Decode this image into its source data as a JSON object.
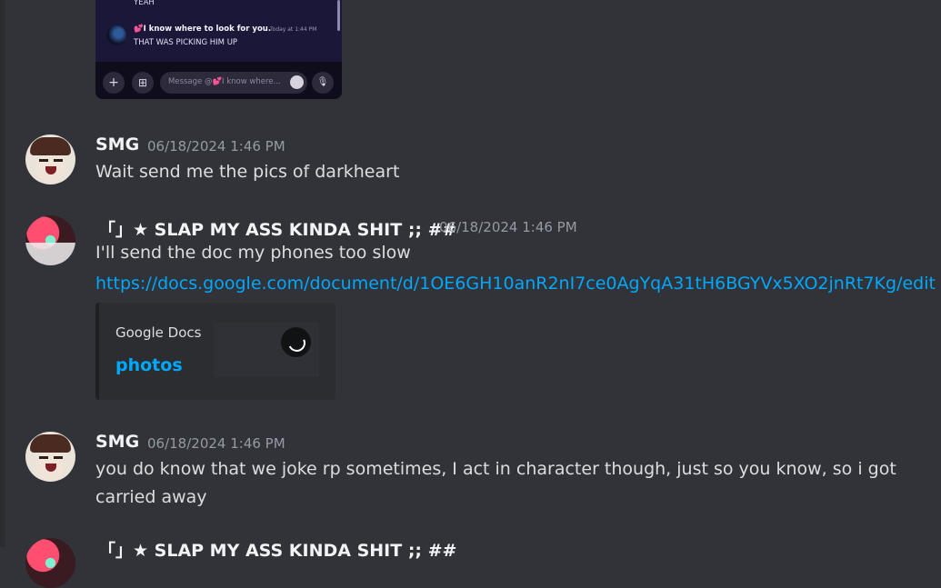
{
  "screenshot_attachment": {
    "top_line": "YEAH",
    "username_prefix": "💕",
    "username": "I know where to look for you.",
    "timestamp": "Today at 1:44 PM",
    "message": "THAT WAS PICKING HIM UP",
    "plus_glyph": "+",
    "gift_glyph": "⊞",
    "mic_glyph": "🎙",
    "input_placeholder": "Message @💕I know where..."
  },
  "messages": [
    {
      "username": "SMG",
      "timestamp": "06/18/2024 1:46 PM",
      "text": "Wait send me the pics of darkheart"
    },
    {
      "username": "「」★ SLAP MY ASS KINDA SHIT ;; ##",
      "timestamp": "06/18/2024 1:46 PM",
      "text": "I'll send the doc my phones too slow",
      "link": "https://docs.google.com/document/d/1OE6GH10anR2nI7ce0AgYqA31tH6BGYVx5XO2jnRt7Kg/edit",
      "embed": {
        "provider": "Google Docs",
        "title": "photos"
      }
    },
    {
      "username": "SMG",
      "timestamp": "06/18/2024 1:46 PM",
      "text": "you do know that we joke rp sometimes, I act in character though, just so you know, so i got carried away"
    },
    {
      "username": "「」★ SLAP MY ASS KINDA SHIT ;; ##"
    }
  ],
  "colors": {
    "background": "#313338",
    "link": "#00a8fc",
    "timestamp": "#949ba4",
    "username": "#f2f3f5"
  }
}
